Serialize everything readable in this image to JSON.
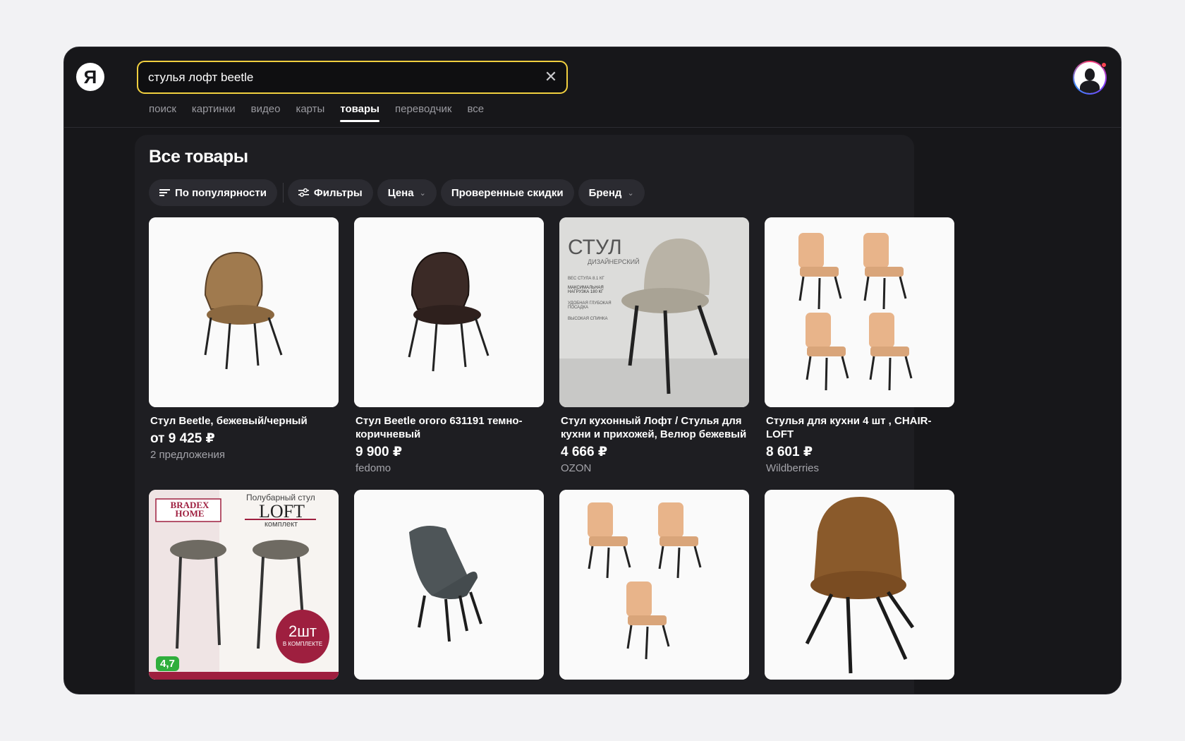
{
  "search": {
    "query": "стулья лофт beetle"
  },
  "logo": {
    "glyph": "Я"
  },
  "tabs": [
    "поиск",
    "картинки",
    "видео",
    "карты",
    "товары",
    "переводчик",
    "все"
  ],
  "active_tab": "товары",
  "page": {
    "title": "Все товары"
  },
  "filters": {
    "sort": "По популярности",
    "filters": "Фильтры",
    "price": "Цена",
    "discounts": "Проверенные скидки",
    "brand": "Бренд"
  },
  "products": [
    {
      "title": "Стул Beetle, бежевый/черный",
      "price": "от 9 425 ₽",
      "shop": "2 предложения",
      "icon": "chair-beige-icon"
    },
    {
      "title": "Стул Beetle огого 631191 темно-коричневый",
      "price": "9 900 ₽",
      "shop": "fedomo",
      "icon": "chair-brown-icon"
    },
    {
      "title": "Стул кухонный Лофт / Стулья для кухни и прихожей, Велюр бежевый",
      "price": "4 666 ₽",
      "shop": "OZON",
      "icon": "chair-velour-icon",
      "image_text": {
        "heading": "СТУЛ",
        "sub": "ДИЗАЙНЕРСКИЙ",
        "spec1": "ВЕС СТУЛА 8.1 КГ",
        "spec2": "МАКСИМАЛЬНАЯ НАГРУЗКА 180 КГ",
        "spec3": "УДОБНАЯ ГЛУБОКАЯ ПОСАДКА",
        "spec4": "ВЫСОКАЯ СПИНКА"
      }
    },
    {
      "title": "Стулья для кухни 4 шт , CHAIR-LOFT",
      "price": "8 601 ₽",
      "shop": "Wildberries",
      "icon": "chairs-set-icon"
    },
    {
      "icon": "bar-stools-icon",
      "rating": "4,7",
      "image_text": {
        "brand": "BRADEX HOME",
        "caption": "Полубарный стул",
        "name": "LOFT",
        "set": "комплект",
        "count": "2шт",
        "count_sub": "В КОМПЛЕКТЕ"
      }
    },
    {
      "icon": "chair-grey-icon"
    },
    {
      "icon": "chairs-three-icon"
    },
    {
      "icon": "chair-leather-icon"
    }
  ],
  "colors": {
    "accent": "#f0cf3f",
    "background": "#17171a",
    "panel": "#1e1e22",
    "badge": "#2fae3c"
  }
}
